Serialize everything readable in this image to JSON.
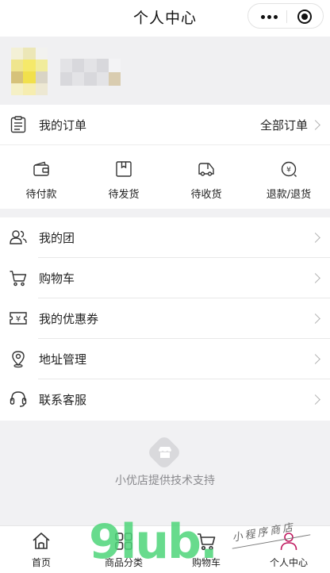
{
  "header": {
    "title": "个人中心",
    "menu_icon": "more-dots-icon",
    "close_icon": "target-circle-icon"
  },
  "profile": {
    "avatar_icon": "pixelated-avatar",
    "nickname_icon": "pixelated-nickname"
  },
  "orders": {
    "title": "我的订单",
    "all_label": "全部订单",
    "icon": "clipboard-icon",
    "statuses": [
      {
        "label": "待付款",
        "icon": "wallet-icon"
      },
      {
        "label": "待发货",
        "icon": "package-icon"
      },
      {
        "label": "待收货",
        "icon": "truck-icon"
      },
      {
        "label": "退款/退货",
        "icon": "refund-icon"
      }
    ]
  },
  "menu": [
    {
      "label": "我的团",
      "icon": "group-icon"
    },
    {
      "label": "购物车",
      "icon": "cart-icon"
    },
    {
      "label": "我的优惠券",
      "icon": "coupon-icon"
    },
    {
      "label": "地址管理",
      "icon": "location-icon"
    },
    {
      "label": "联系客服",
      "icon": "headset-icon"
    }
  ],
  "support": {
    "text": "小优店提供技术支持",
    "icon": "shop-logo-icon"
  },
  "tabbar": [
    {
      "label": "首页",
      "icon": "home-icon"
    },
    {
      "label": "商品分类",
      "icon": "grid-icon"
    },
    {
      "label": "购物车",
      "icon": "cart-icon"
    },
    {
      "label": "个人中心",
      "icon": "person-icon"
    }
  ],
  "watermark": {
    "big": "9lub.",
    "small": "小程序商店"
  },
  "colors": {
    "page_bg": "#f1f1f3",
    "card_bg": "#ffffff",
    "text": "#222222",
    "muted": "#8a8a8e",
    "active_tab": "#c0185f",
    "watermark_green": "#4ed57a"
  }
}
